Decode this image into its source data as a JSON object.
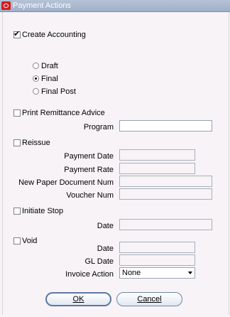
{
  "window": {
    "title": "Payment Actions"
  },
  "create_accounting": {
    "label": "Create Accounting",
    "checked": true,
    "options": [
      {
        "label": "Draft",
        "selected": false
      },
      {
        "label": "Final",
        "selected": true
      },
      {
        "label": "Final Post",
        "selected": false
      }
    ]
  },
  "print_remittance": {
    "label": "Print Remittance Advice",
    "checked": false,
    "program_label": "Program",
    "program_value": ""
  },
  "reissue": {
    "label": "Reissue",
    "checked": false,
    "payment_date_label": "Payment Date",
    "payment_rate_label": "Payment Rate",
    "new_paper_doc_label": "New Paper Document Num",
    "voucher_num_label": "Voucher Num"
  },
  "initiate_stop": {
    "label": "Initiate Stop",
    "checked": false,
    "date_label": "Date"
  },
  "void": {
    "label": "Void",
    "checked": false,
    "date_label": "Date",
    "gl_date_label": "GL Date",
    "invoice_action_label": "Invoice Action",
    "invoice_action_value": "None"
  },
  "buttons": {
    "ok": "OK",
    "cancel": "Cancel"
  }
}
